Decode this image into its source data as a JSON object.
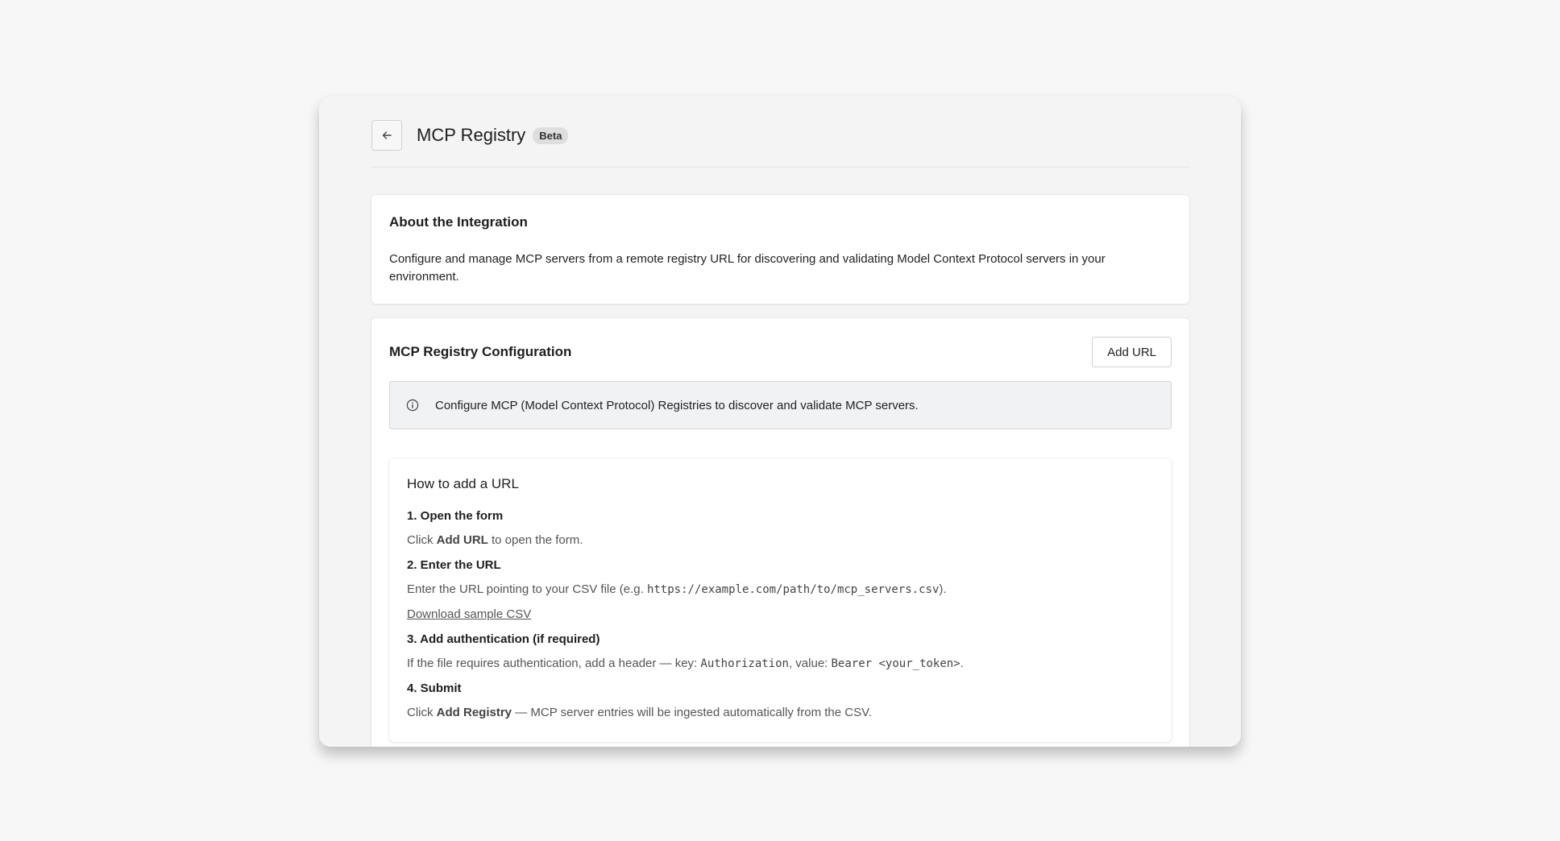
{
  "header": {
    "title": "MCP Registry",
    "badge": "Beta",
    "back_icon": "arrow-left-icon"
  },
  "about": {
    "title": "About the Integration",
    "description": "Configure and manage MCP servers from a remote registry URL for discovering and validating Model Context Protocol servers in your environment."
  },
  "config": {
    "title": "MCP Registry Configuration",
    "add_url_label": "Add URL",
    "info_icon": "info-circle-icon",
    "info_text": "Configure MCP (Model Context Protocol) Registries to discover and validate MCP servers."
  },
  "howto": {
    "title": "How to add a URL",
    "step1_title": "1. Open the form",
    "step1_pre": "Click ",
    "step1_bold": "Add URL",
    "step1_post": " to open the form.",
    "step2_title": "2. Enter the URL",
    "step2_pre": "Enter the URL pointing to your CSV file (e.g. ",
    "step2_code": "https://example.com/path/to/mcp_servers.csv",
    "step2_post": ").",
    "download_link": "Download sample CSV",
    "step3_title": "3. Add authentication (if required)",
    "step3_pre": "If the file requires authentication, add a header — key: ",
    "step3_code_key": "Authorization",
    "step3_mid": ", value: ",
    "step3_code_value": "Bearer <your_token>",
    "step3_post": ".",
    "step4_title": "4. Submit",
    "step4_pre": "Click ",
    "step4_bold": "Add Registry",
    "step4_post": " — MCP server entries will be ingested automatically from the CSV."
  }
}
